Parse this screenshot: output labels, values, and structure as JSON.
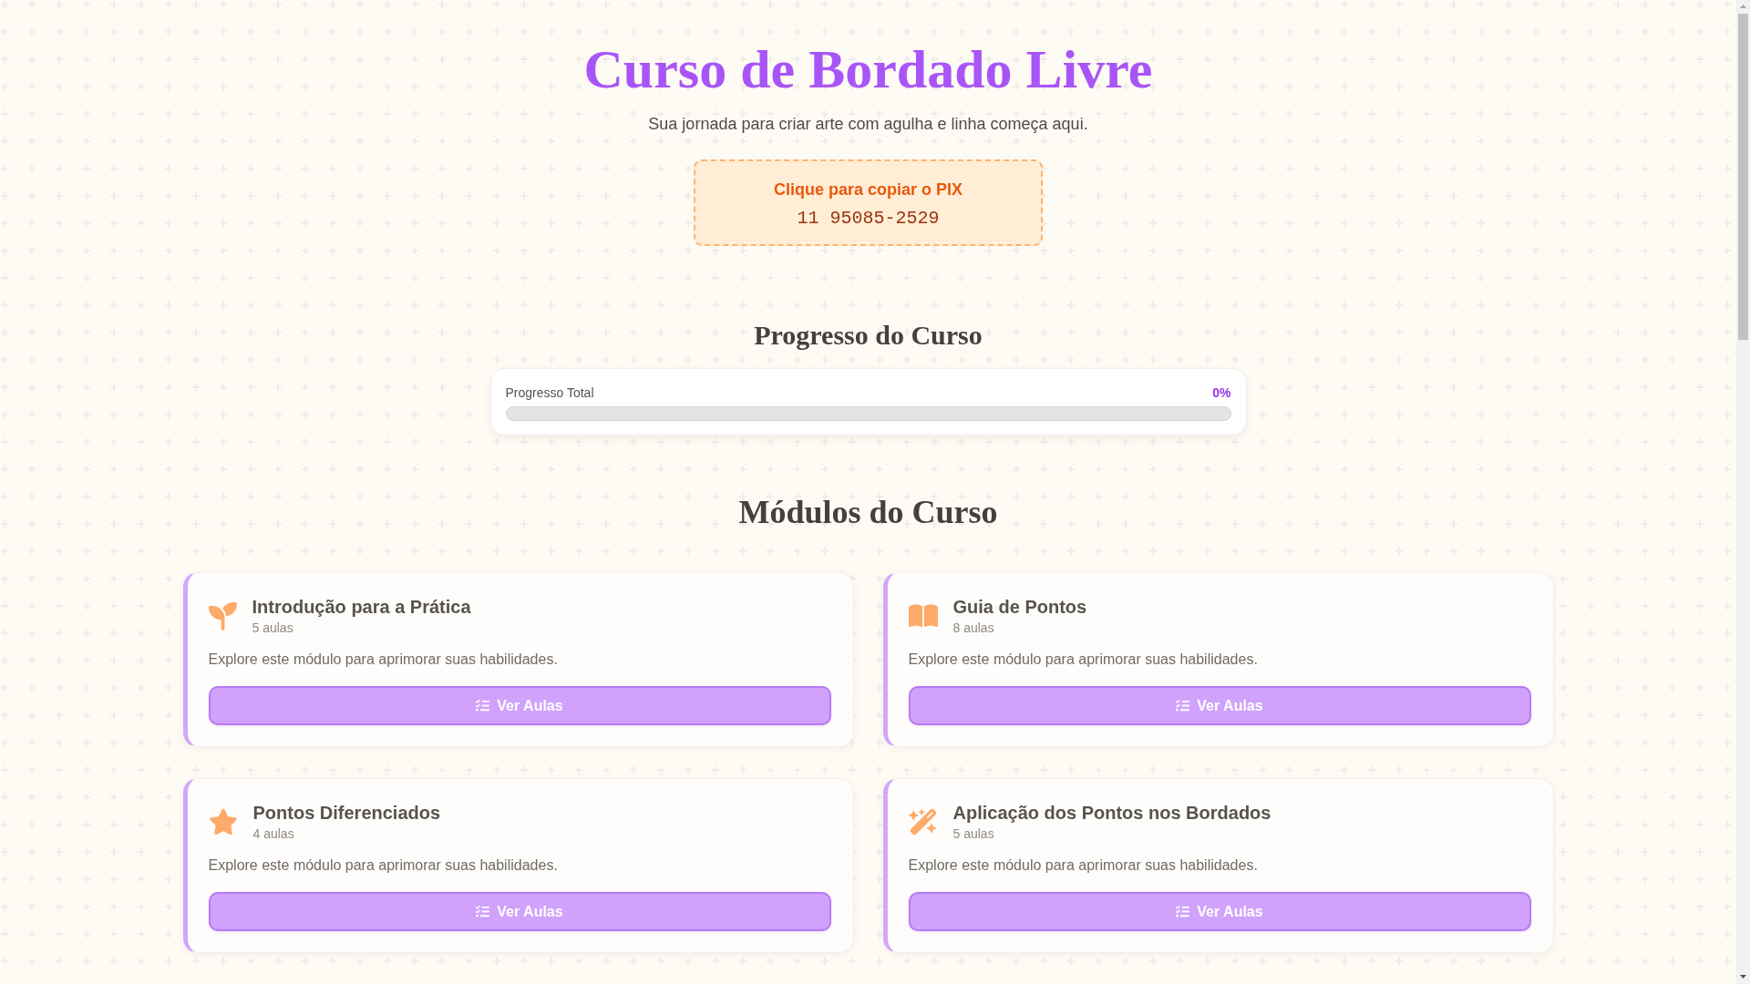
{
  "header": {
    "title": "Curso de Bordado Livre",
    "subtitle": "Sua jornada para criar arte com agulha e linha começa aqui.",
    "pix": {
      "label": "Clique para copiar o PIX",
      "value": "11 95085-2529"
    }
  },
  "progress": {
    "heading": "Progresso do Curso",
    "label": "Progresso Total",
    "percent": "0%",
    "level": 0
  },
  "modules": {
    "heading": "Módulos do Curso",
    "items": [
      {
        "title": "Introdução para a Prática",
        "count": "5 aulas",
        "description": "Explore este módulo para aprimorar suas habilidades.",
        "button": "Ver Aulas"
      },
      {
        "title": "Guia de Pontos",
        "count": "8 aulas",
        "description": "Explore este módulo para aprimorar suas habilidades.",
        "button": "Ver Aulas"
      },
      {
        "title": "Pontos Diferenciados",
        "count": "4 aulas",
        "description": "Explore este módulo para aprimorar suas habilidades.",
        "button": "Ver Aulas"
      },
      {
        "title": "Aplicação dos Pontos nos Bordados",
        "count": "5 aulas",
        "description": "Explore este módulo para aprimorar suas habilidades.",
        "button": "Ver Aulas"
      }
    ]
  }
}
